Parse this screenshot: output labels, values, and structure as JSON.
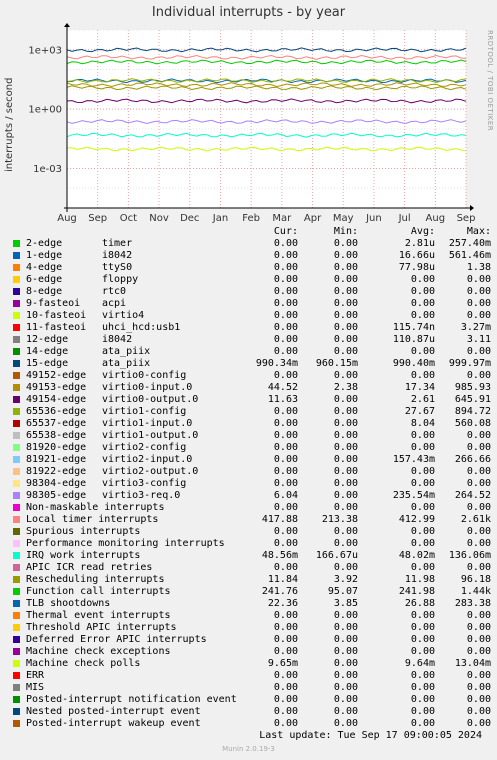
{
  "title": "Individual interrupts - by year",
  "sidebar_text": "RRDTOOL / TOBI OETIKER",
  "ylabel": "interrupts / second",
  "chart_data": {
    "type": "line",
    "scale": "log",
    "ylim": [
      1e-05,
      10000
    ],
    "y_ticks": [
      {
        "value": 1000,
        "label": "1e+03"
      },
      {
        "value": 1,
        "label": "1e+00"
      },
      {
        "value": 0.001,
        "label": "1e-03"
      }
    ],
    "x_ticks": [
      "Aug",
      "Sep",
      "Oct",
      "Nov",
      "Dec",
      "Jan",
      "Feb",
      "Mar",
      "Apr",
      "May",
      "Jun",
      "Jul",
      "Aug",
      "Sep"
    ],
    "grid": true,
    "levels": [
      {
        "name": "15-edge",
        "value": 990.3
      },
      {
        "name": "Function call interrupts",
        "value": 242
      },
      {
        "name": "Local timer interrupts",
        "value": 413
      },
      {
        "name": "TLB shootdowns",
        "value": 26.9
      },
      {
        "name": "Rescheduling interrupts",
        "value": 12
      },
      {
        "name": "49153-edge",
        "value": 17.3
      },
      {
        "name": "65536-edge",
        "value": 27.7
      },
      {
        "name": "49154-edge",
        "value": 2.6
      },
      {
        "name": "98305-edge",
        "value": 0.235
      },
      {
        "name": "IRQ work interrupts",
        "value": 0.048
      },
      {
        "name": "Machine check polls",
        "value": 0.0096
      }
    ]
  },
  "legend": {
    "headers": {
      "cur": "Cur:",
      "min": "Min:",
      "avg": "Avg:",
      "max": "Max:"
    },
    "rows": [
      {
        "name": "2-edge",
        "device": "timer",
        "cur": "0.00",
        "min": "0.00",
        "avg": "2.81u",
        "max": "257.40m",
        "color": "#00cc00"
      },
      {
        "name": "1-edge",
        "device": "i8042",
        "cur": "0.00",
        "min": "0.00",
        "avg": "16.66u",
        "max": "561.46m",
        "color": "#0066b3"
      },
      {
        "name": "4-edge",
        "device": "ttyS0",
        "cur": "0.00",
        "min": "0.00",
        "avg": "77.98u",
        "max": "1.38",
        "color": "#ff8000"
      },
      {
        "name": "6-edge",
        "device": "floppy",
        "cur": "0.00",
        "min": "0.00",
        "avg": "0.00",
        "max": "0.00",
        "color": "#ffcc00"
      },
      {
        "name": "8-edge",
        "device": "rtc0",
        "cur": "0.00",
        "min": "0.00",
        "avg": "0.00",
        "max": "0.00",
        "color": "#330099"
      },
      {
        "name": "9-fasteoi",
        "device": "acpi",
        "cur": "0.00",
        "min": "0.00",
        "avg": "0.00",
        "max": "0.00",
        "color": "#990099"
      },
      {
        "name": "10-fasteoi",
        "device": "virtio4",
        "cur": "0.00",
        "min": "0.00",
        "avg": "0.00",
        "max": "0.00",
        "color": "#ccff00"
      },
      {
        "name": "11-fasteoi",
        "device": "uhci_hcd:usb1",
        "cur": "0.00",
        "min": "0.00",
        "avg": "115.74n",
        "max": "3.27m",
        "color": "#ff0000"
      },
      {
        "name": "12-edge",
        "device": "i8042",
        "cur": "0.00",
        "min": "0.00",
        "avg": "110.87u",
        "max": "3.11",
        "color": "#808080"
      },
      {
        "name": "14-edge",
        "device": "ata_piix",
        "cur": "0.00",
        "min": "0.00",
        "avg": "0.00",
        "max": "0.00",
        "color": "#008f00"
      },
      {
        "name": "15-edge",
        "device": "ata_piix",
        "cur": "990.34m",
        "min": "960.15m",
        "avg": "990.40m",
        "max": "999.97m",
        "color": "#00487d"
      },
      {
        "name": "49152-edge",
        "device": "virtio0-config",
        "cur": "0.00",
        "min": "0.00",
        "avg": "0.00",
        "max": "0.00",
        "color": "#b35a00"
      },
      {
        "name": "49153-edge",
        "device": "virtio0-input.0",
        "cur": "44.52",
        "min": "2.38",
        "avg": "17.34",
        "max": "985.93",
        "color": "#b38f00"
      },
      {
        "name": "49154-edge",
        "device": "virtio0-output.0",
        "cur": "11.63",
        "min": "0.00",
        "avg": "2.61",
        "max": "645.91",
        "color": "#6b006b"
      },
      {
        "name": "65536-edge",
        "device": "virtio1-config",
        "cur": "0.00",
        "min": "0.00",
        "avg": "27.67",
        "max": "894.72",
        "color": "#8fb300"
      },
      {
        "name": "65537-edge",
        "device": "virtio1-input.0",
        "cur": "0.00",
        "min": "0.00",
        "avg": "8.04",
        "max": "560.08",
        "color": "#b30000"
      },
      {
        "name": "65538-edge",
        "device": "virtio1-output.0",
        "cur": "0.00",
        "min": "0.00",
        "avg": "0.00",
        "max": "0.00",
        "color": "#bebebe"
      },
      {
        "name": "81920-edge",
        "device": "virtio2-config",
        "cur": "0.00",
        "min": "0.00",
        "avg": "0.00",
        "max": "0.00",
        "color": "#80ff80"
      },
      {
        "name": "81921-edge",
        "device": "virtio2-input.0",
        "cur": "0.00",
        "min": "0.00",
        "avg": "157.43m",
        "max": "266.66",
        "color": "#80c9ff"
      },
      {
        "name": "81922-edge",
        "device": "virtio2-output.0",
        "cur": "0.00",
        "min": "0.00",
        "avg": "0.00",
        "max": "0.00",
        "color": "#ffc080"
      },
      {
        "name": "98304-edge",
        "device": "virtio3-config",
        "cur": "0.00",
        "min": "0.00",
        "avg": "0.00",
        "max": "0.00",
        "color": "#ffe680"
      },
      {
        "name": "98305-edge",
        "device": "virtio3-req.0",
        "cur": "6.04",
        "min": "0.00",
        "avg": "235.54m",
        "max": "264.52",
        "color": "#aa80ff"
      },
      {
        "name": "Non-maskable interrupts",
        "device": "",
        "cur": "0.00",
        "min": "0.00",
        "avg": "0.00",
        "max": "0.00",
        "color": "#ee00cc"
      },
      {
        "name": "Local timer interrupts",
        "device": "",
        "cur": "417.88",
        "min": "213.38",
        "avg": "412.99",
        "max": "2.61k",
        "color": "#ff8080"
      },
      {
        "name": "Spurious interrupts",
        "device": "",
        "cur": "0.00",
        "min": "0.00",
        "avg": "0.00",
        "max": "0.00",
        "color": "#666600"
      },
      {
        "name": "Performance monitoring interrupts",
        "device": "",
        "cur": "0.00",
        "min": "0.00",
        "avg": "0.00",
        "max": "0.00",
        "color": "#ffbfff"
      },
      {
        "name": "IRQ work interrupts",
        "device": "",
        "cur": "48.56m",
        "min": "166.67u",
        "avg": "48.02m",
        "max": "136.06m",
        "color": "#00ffcc"
      },
      {
        "name": "APIC ICR read retries",
        "device": "",
        "cur": "0.00",
        "min": "0.00",
        "avg": "0.00",
        "max": "0.00",
        "color": "#cc6699"
      },
      {
        "name": "Rescheduling interrupts",
        "device": "",
        "cur": "11.84",
        "min": "3.92",
        "avg": "11.98",
        "max": "96.18",
        "color": "#999900"
      },
      {
        "name": "Function call interrupts",
        "device": "",
        "cur": "241.76",
        "min": "95.07",
        "avg": "241.98",
        "max": "1.44k",
        "color": "#00cc00"
      },
      {
        "name": "TLB shootdowns",
        "device": "",
        "cur": "22.36",
        "min": "3.85",
        "avg": "26.88",
        "max": "283.38",
        "color": "#0066b3"
      },
      {
        "name": "Thermal event interrupts",
        "device": "",
        "cur": "0.00",
        "min": "0.00",
        "avg": "0.00",
        "max": "0.00",
        "color": "#ff8000"
      },
      {
        "name": "Threshold APIC interrupts",
        "device": "",
        "cur": "0.00",
        "min": "0.00",
        "avg": "0.00",
        "max": "0.00",
        "color": "#ffcc00"
      },
      {
        "name": "Deferred Error APIC interrupts",
        "device": "",
        "cur": "0.00",
        "min": "0.00",
        "avg": "0.00",
        "max": "0.00",
        "color": "#330099"
      },
      {
        "name": "Machine check exceptions",
        "device": "",
        "cur": "0.00",
        "min": "0.00",
        "avg": "0.00",
        "max": "0.00",
        "color": "#990099"
      },
      {
        "name": "Machine check polls",
        "device": "",
        "cur": "9.65m",
        "min": "0.00",
        "avg": "9.64m",
        "max": "13.04m",
        "color": "#ccff00"
      },
      {
        "name": "ERR",
        "device": "",
        "cur": "0.00",
        "min": "0.00",
        "avg": "0.00",
        "max": "0.00",
        "color": "#ff0000"
      },
      {
        "name": "MIS",
        "device": "",
        "cur": "0.00",
        "min": "0.00",
        "avg": "0.00",
        "max": "0.00",
        "color": "#808080"
      },
      {
        "name": "Posted-interrupt notification event",
        "device": "",
        "cur": "0.00",
        "min": "0.00",
        "avg": "0.00",
        "max": "0.00",
        "color": "#008f00"
      },
      {
        "name": "Nested posted-interrupt event",
        "device": "",
        "cur": "0.00",
        "min": "0.00",
        "avg": "0.00",
        "max": "0.00",
        "color": "#00487d"
      },
      {
        "name": "Posted-interrupt wakeup event",
        "device": "",
        "cur": "0.00",
        "min": "0.00",
        "avg": "0.00",
        "max": "0.00",
        "color": "#b35a00"
      }
    ]
  },
  "last_update": "Last update:  Tue Sep 17 09:00:05 2024",
  "footer": "Munin 2.0.19-3"
}
